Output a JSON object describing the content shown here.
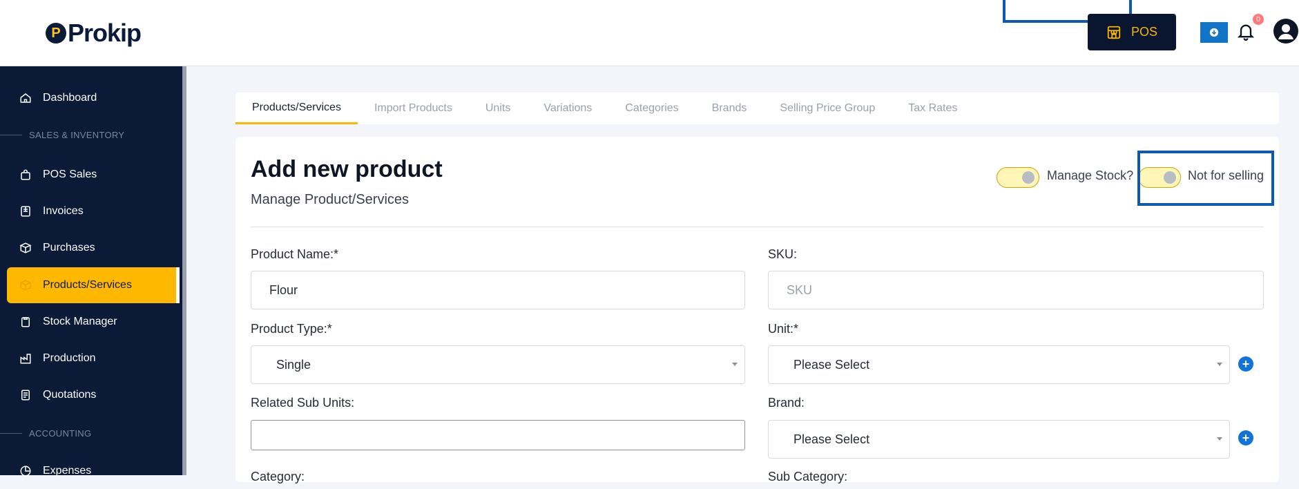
{
  "app": {
    "brand": "Prokip",
    "logo_letter": "P"
  },
  "header": {
    "pos_label": "POS",
    "notification_count": "0"
  },
  "sidebar": {
    "items": [
      {
        "label": "Dashboard",
        "icon": "home-icon"
      },
      {
        "section": "SALES & INVENTORY"
      },
      {
        "label": "POS Sales",
        "icon": "shopping-bag-icon"
      },
      {
        "label": "Invoices",
        "icon": "invoice-icon"
      },
      {
        "label": "Purchases",
        "icon": "box-icon"
      },
      {
        "label": "Products/Services",
        "icon": "cube-icon",
        "active": true
      },
      {
        "label": "Stock Manager",
        "icon": "clipboard-icon"
      },
      {
        "label": "Production",
        "icon": "factory-icon"
      },
      {
        "label": "Quotations",
        "icon": "document-icon"
      },
      {
        "section": "ACCOUNTING"
      },
      {
        "label": "Expenses",
        "icon": "pie-icon"
      }
    ]
  },
  "tabs": [
    {
      "label": "Products/Services",
      "active": true
    },
    {
      "label": "Import Products"
    },
    {
      "label": "Units"
    },
    {
      "label": "Variations"
    },
    {
      "label": "Categories"
    },
    {
      "label": "Brands"
    },
    {
      "label": "Selling Price Group"
    },
    {
      "label": "Tax Rates"
    }
  ],
  "form": {
    "title": "Add new product",
    "subtitle": "Manage Product/Services",
    "manage_stock_label": "Manage Stock?",
    "not_for_selling_label": "Not for selling",
    "product_name_label": "Product Name:*",
    "product_name_value": "Flour",
    "sku_label": "SKU:",
    "sku_placeholder": "SKU",
    "product_type_label": "Product Type:*",
    "product_type_value": "Single",
    "unit_label": "Unit:*",
    "unit_value": "Please Select",
    "related_sub_units_label": "Related Sub Units:",
    "brand_label": "Brand:",
    "brand_value": "Please Select",
    "category_label": "Category:",
    "sub_category_label": "Sub Category:"
  },
  "colors": {
    "accent": "#ffb800",
    "sidebar_bg": "#0b1a37",
    "highlight_outline": "#0d57b5",
    "link_blue": "#1274d8"
  }
}
